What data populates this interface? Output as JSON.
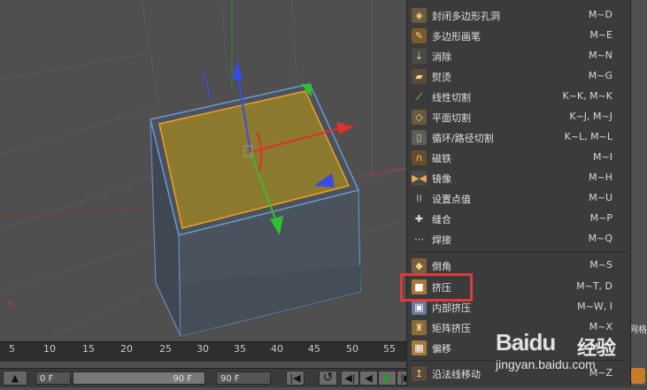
{
  "timeline": {
    "ticks": [
      "5",
      "10",
      "15",
      "20",
      "25",
      "30",
      "35",
      "40",
      "45",
      "50",
      "55"
    ]
  },
  "transport": {
    "start_frame": "0 F",
    "end_frame": "90 F",
    "current_frame": "90 F"
  },
  "menu": {
    "items": [
      {
        "label": "封闭多边形孔洞",
        "shortcut": "M~D",
        "icon": "close-hole-icon"
      },
      {
        "label": "多边形画笔",
        "shortcut": "M~E",
        "icon": "polygon-pen-icon"
      },
      {
        "label": "消除",
        "shortcut": "M~N",
        "icon": "dissolve-icon"
      },
      {
        "label": "熨烫",
        "shortcut": "M~G",
        "icon": "iron-icon"
      },
      {
        "label": "线性切割",
        "shortcut": "K~K, M~K",
        "icon": "knife-icon"
      },
      {
        "label": "平面切割",
        "shortcut": "K~J, M~J",
        "icon": "plane-cut-icon"
      },
      {
        "label": "循环/路径切割",
        "shortcut": "K~L, M~L",
        "icon": "loop-cut-icon"
      },
      {
        "label": "磁铁",
        "shortcut": "M~I",
        "icon": "magnet-icon"
      },
      {
        "label": "镜像",
        "shortcut": "M~H",
        "icon": "mirror-icon"
      },
      {
        "label": "设置点值",
        "shortcut": "M~U",
        "icon": "set-point-value-icon"
      },
      {
        "label": "缝合",
        "shortcut": "M~P",
        "icon": "stitch-icon"
      },
      {
        "label": "焊接",
        "shortcut": "M~Q",
        "icon": "weld-icon"
      },
      {
        "label": "倒角",
        "shortcut": "M~S",
        "icon": "bevel-icon"
      },
      {
        "label": "挤压",
        "shortcut": "M~T, D",
        "icon": "extrude-icon"
      },
      {
        "label": "内部挤压",
        "shortcut": "M~W, I",
        "icon": "extrude-inner-icon"
      },
      {
        "label": "矩阵挤压",
        "shortcut": "M~X",
        "icon": "matrix-extrude-icon"
      },
      {
        "label": "偏移",
        "shortcut": "M~Y",
        "icon": "offset-icon"
      },
      {
        "label": "沿法线移动",
        "shortcut": "M~Z",
        "icon": "normal-move-icon"
      }
    ]
  },
  "watermark": {
    "brand": "Baidu",
    "brand_suffix": "经验",
    "url": "jingyan.baidu.com"
  },
  "right_strip_text": "网格",
  "colors": {
    "selected_face": "#8c7a2e",
    "highlight": "#e03b3b",
    "menu_bg": "#3b3b3b",
    "axis_x": "#e03030",
    "axis_y": "#30c030",
    "axis_z": "#3050e0"
  }
}
